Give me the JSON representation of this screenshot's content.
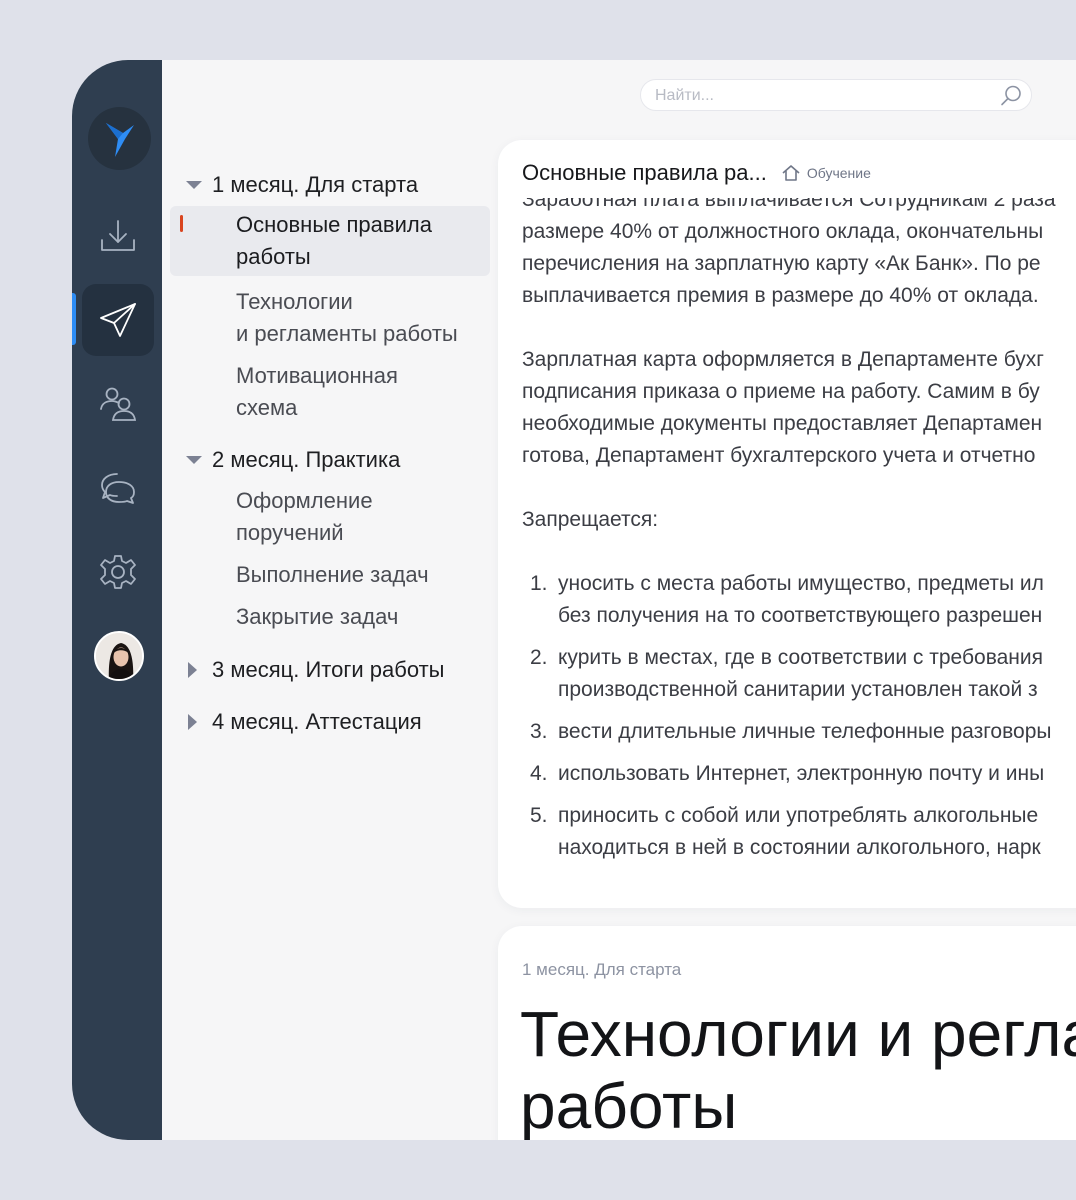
{
  "search": {
    "placeholder": "Найти..."
  },
  "rail": {
    "icons": [
      "logo-bird-icon",
      "download-icon",
      "send-icon",
      "users-icon",
      "chat-icon",
      "gear-icon",
      "avatar"
    ],
    "active": "send-icon",
    "colors": {
      "rail_bg": "#2f3e50",
      "accent": "#2e8df5",
      "logo": "#2e8df5"
    }
  },
  "toc": {
    "sections": [
      {
        "title": "1 месяц. Для старта",
        "expanded": true,
        "items": [
          {
            "lines": [
              "Основные правила",
              "работы"
            ],
            "active": true
          },
          {
            "lines": [
              "Технологии",
              "и регламенты работы"
            ]
          },
          {
            "lines": [
              "Мотивационная",
              "схема"
            ]
          }
        ]
      },
      {
        "title": "2 месяц. Практика",
        "expanded": true,
        "items": [
          {
            "lines": [
              "Оформление",
              "поручений"
            ]
          },
          {
            "lines": [
              "Выполнение задач"
            ]
          },
          {
            "lines": [
              "Закрытие задач"
            ]
          }
        ]
      },
      {
        "title": "3 месяц. Итоги работы",
        "expanded": false,
        "items": []
      },
      {
        "title": "4 месяц. Аттестация",
        "expanded": false,
        "items": []
      }
    ],
    "active_marker_color": "#d9451f"
  },
  "article": {
    "title": "Основные правила ра...",
    "breadcrumb": "Обучение",
    "paragraph1": [
      "Заработная плата выплачивается Сотрудникам 2 раза",
      "размере 40% от должностного оклада, окончательны",
      "перечисления на зарплатную карту «Ак Банк». По ре",
      "выплачивается премия в размере до 40% от оклада."
    ],
    "paragraph2": [
      "Зарплатная карта оформляется в Департаменте бухг",
      "подписания приказа о приеме на работу. Самим в бу",
      "необходимые документы предоставляет Департамен",
      "готова, Департамент бухгалтерского учета и отчетно"
    ],
    "forbidden_heading": "Запрещается:",
    "list": [
      {
        "num": "1.",
        "lines": [
          "уносить с места работы имущество, предметы ил",
          "без получения на то соответствующего разрешен"
        ]
      },
      {
        "num": "2.",
        "lines": [
          "курить в местах, где в соответствии с требования",
          "производственной санитарии установлен такой з"
        ]
      },
      {
        "num": "3.",
        "lines": [
          "вести длительные личные телефонные разговоры"
        ]
      },
      {
        "num": "4.",
        "lines": [
          "использовать Интернет, электронную почту и ины"
        ]
      },
      {
        "num": "5.",
        "lines": [
          "приносить с собой или употреблять алкогольные",
          "находиться в ней в состоянии алкогольного, нарк"
        ]
      }
    ]
  },
  "next_article": {
    "breadcrumb": "1 месяц. Для старта",
    "title_lines": [
      "Технологии и регла",
      "работы"
    ]
  }
}
